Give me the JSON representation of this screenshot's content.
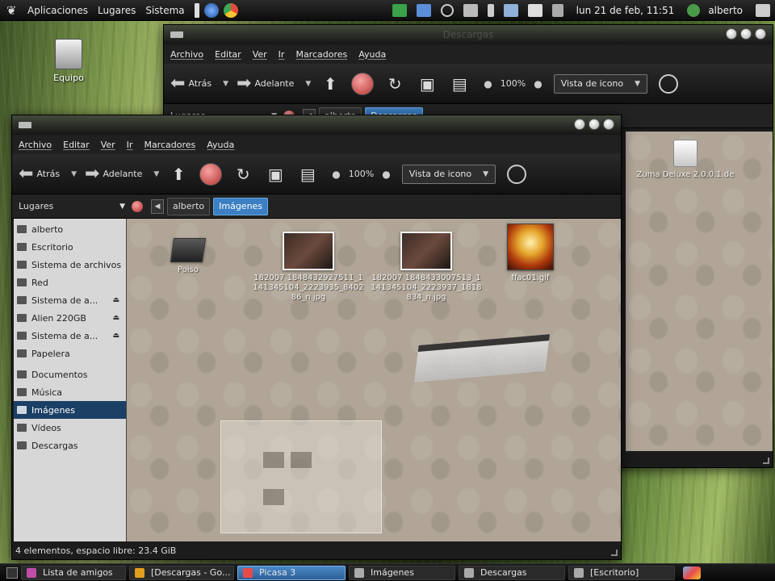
{
  "top_panel": {
    "menus": [
      "Aplicaciones",
      "Lugares",
      "Sistema"
    ],
    "clock": "lun 21 de feb, 11:51",
    "user": "alberto"
  },
  "desktop": {
    "icon_label": "Equipo"
  },
  "back_window": {
    "title": "Descargas",
    "menus": [
      "Archivo",
      "Editar",
      "Ver",
      "Ir",
      "Marcadores",
      "Ayuda"
    ],
    "back_label": "Atrás",
    "forward_label": "Adelante",
    "zoom": "100%",
    "view_mode": "Vista de icono",
    "places_label": "Lugares",
    "crumbs": [
      "alberto",
      "Descargas"
    ],
    "file_name": "Zuma Deluxe 2.0.0.1.de"
  },
  "front_window": {
    "menus": [
      "Archivo",
      "Editar",
      "Ver",
      "Ir",
      "Marcadores",
      "Ayuda"
    ],
    "back_label": "Atrás",
    "forward_label": "Adelante",
    "zoom": "100%",
    "view_mode": "Vista de icono",
    "places_label": "Lugares",
    "crumbs": [
      "alberto",
      "Imágenes"
    ],
    "sidebar": [
      {
        "label": "alberto",
        "eject": false
      },
      {
        "label": "Escritorio",
        "eject": false
      },
      {
        "label": "Sistema de archivos",
        "eject": false
      },
      {
        "label": "Red",
        "eject": false
      },
      {
        "label": "Sistema de a...",
        "eject": true
      },
      {
        "label": "Alien 220GB",
        "eject": true
      },
      {
        "label": "Sistema de a...",
        "eject": true
      },
      {
        "label": "Papelera",
        "eject": false
      },
      {
        "label": "Documentos",
        "eject": false
      },
      {
        "label": "Música",
        "eject": false
      },
      {
        "label": "Imágenes",
        "eject": false,
        "selected": true
      },
      {
        "label": "Vídeos",
        "eject": false
      },
      {
        "label": "Descargas",
        "eject": false
      }
    ],
    "files": [
      {
        "name": "Poiso",
        "kind": "folder"
      },
      {
        "name": "182007 1848432927511_1141345104_2223935_840286_n.jpg",
        "kind": "photo"
      },
      {
        "name": "182007 1848433007513_1141345104_2223937_1818834_n.jpg",
        "kind": "photo"
      },
      {
        "name": "ffac01.gif",
        "kind": "gif"
      }
    ],
    "status": "4 elementos, espacio libre: 23.4 GiB"
  },
  "taskbar": [
    {
      "label": "Lista de amigos",
      "active": false,
      "color": "#c04da8"
    },
    {
      "label": "[Descargas - Go...",
      "active": false,
      "color": "#e0a020"
    },
    {
      "label": "Picasa 3",
      "active": true,
      "color": "#e84a4a"
    },
    {
      "label": "Imágenes",
      "active": false,
      "color": "#aaaaaa"
    },
    {
      "label": "Descargas",
      "active": false,
      "color": "#aaaaaa"
    },
    {
      "label": "[Escritorio]",
      "active": false,
      "color": "#aaaaaa"
    }
  ]
}
